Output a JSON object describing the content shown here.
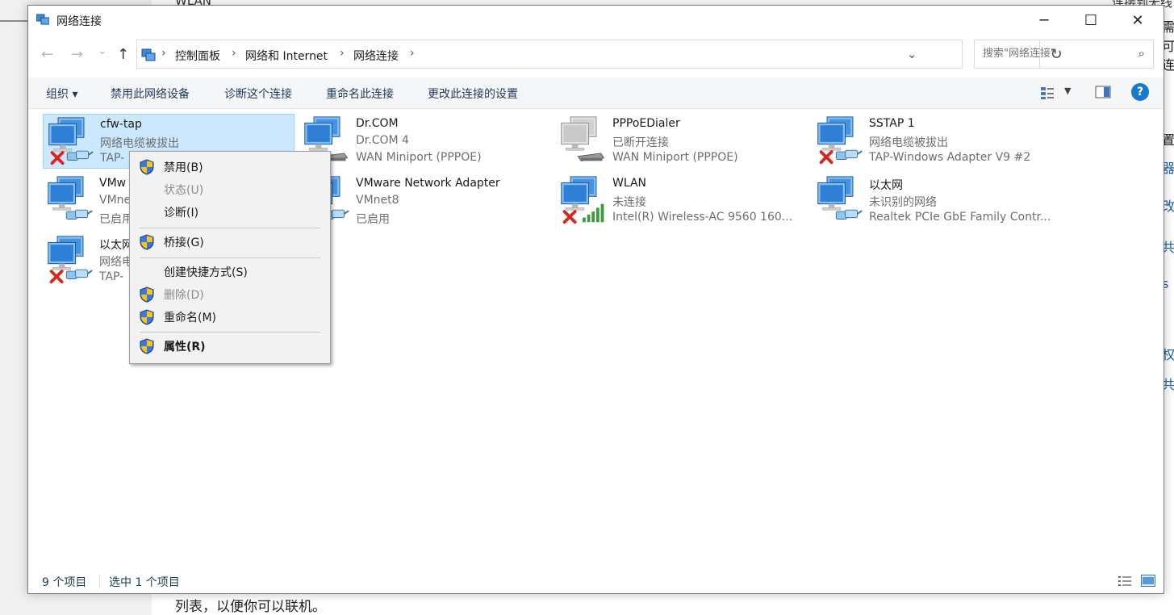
{
  "background": {
    "bottom_text": "列表，以便你可以联机。",
    "top_text_left": "WLAN",
    "top_text_right": "连接到无线",
    "right_fragments": [
      "需要",
      "可用",
      "连接",
      "置",
      "器",
      "改共",
      "共享",
      "s |",
      "权",
      "共"
    ]
  },
  "window": {
    "title": "网络连接",
    "minimize": "─",
    "maximize": "☐",
    "close": "✕"
  },
  "nav": {
    "back": "←",
    "forward": "→",
    "recent": "⌄",
    "up": "↑",
    "breadcrumbs": [
      "控制面板",
      "网络和 Internet",
      "网络连接"
    ],
    "refresh": "↻",
    "search_placeholder": "搜索\"网络连接\""
  },
  "toolbar": {
    "organize": "组织 ▾",
    "disable": "禁用此网络设备",
    "diagnose": "诊断这个连接",
    "rename": "重命名此连接",
    "change_settings": "更改此连接的设置",
    "help": "?"
  },
  "connections": [
    {
      "name": "cfw-tap",
      "status": "网络电缆被拔出",
      "device": "TAP-",
      "state": "disconnected",
      "type": "ethernet"
    },
    {
      "name": "Dr.COM",
      "status": "Dr.COM 4",
      "device": "WAN Miniport (PPPOE)",
      "state": "ok",
      "type": "modem"
    },
    {
      "name": "PPPoEDialer",
      "status": "已断开连接",
      "device": "WAN Miniport (PPPOE)",
      "state": "off",
      "type": "modem"
    },
    {
      "name": "SSTAP 1",
      "status": "网络电缆被拔出",
      "device": "TAP-Windows Adapter V9 #2",
      "state": "disconnected",
      "type": "ethernet"
    },
    {
      "name": "VMw",
      "status": "VMne",
      "device": "已启用",
      "state": "ok",
      "type": "ethernet"
    },
    {
      "name": "VMware Network Adapter",
      "status": "VMnet8",
      "device": "已启用",
      "state": "ok",
      "type": "ethernet"
    },
    {
      "name": "WLAN",
      "status": "未连接",
      "device": "Intel(R) Wireless-AC 9560 160...",
      "state": "disconnected",
      "type": "wifi"
    },
    {
      "name": "以太网",
      "status": "未识别的网络",
      "device": "Realtek PCIe GbE Family Contr...",
      "state": "ok",
      "type": "ethernet"
    },
    {
      "name": "以太网",
      "status": "网络电",
      "device": "TAP-",
      "state": "disconnected",
      "type": "ethernet"
    }
  ],
  "context_menu": {
    "items": [
      {
        "label": "禁用(B)",
        "shield": true,
        "disabled": false
      },
      {
        "label": "状态(U)",
        "shield": false,
        "disabled": true
      },
      {
        "label": "诊断(I)",
        "shield": false,
        "disabled": false
      },
      {
        "label": "桥接(G)",
        "shield": true,
        "disabled": false
      },
      {
        "label": "创建快捷方式(S)",
        "shield": false,
        "disabled": false
      },
      {
        "label": "删除(D)",
        "shield": true,
        "disabled": true
      },
      {
        "label": "重命名(M)",
        "shield": true,
        "disabled": false
      },
      {
        "label": "属性(R)",
        "shield": true,
        "disabled": false,
        "bold": true
      }
    ]
  },
  "statusbar": {
    "count": "9 个项目",
    "selected": "选中 1 个项目"
  },
  "colors": {
    "selection_bg": "#cce8ff",
    "selection_border": "#99d1ff",
    "link_blue": "#1e395b",
    "help_blue": "#1979ca",
    "error_red": "#d9251c",
    "signal_green": "#3c9a3c"
  }
}
